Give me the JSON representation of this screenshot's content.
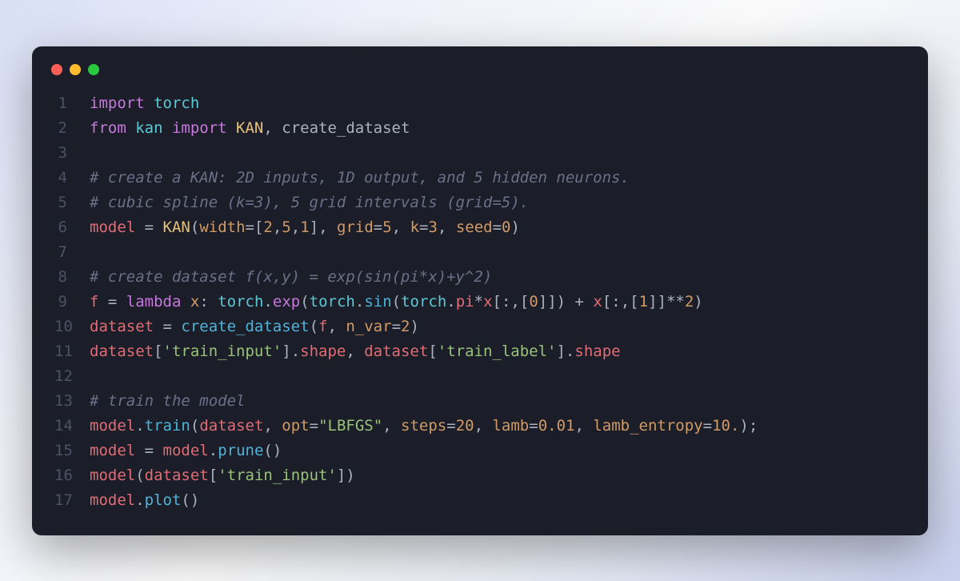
{
  "window": {
    "traffic_lights": [
      "red",
      "yellow",
      "green"
    ]
  },
  "lines": [
    {
      "n": "1",
      "tokens": [
        [
          "kw",
          "import "
        ],
        [
          "mod",
          "torch"
        ]
      ]
    },
    {
      "n": "2",
      "tokens": [
        [
          "kw",
          "from "
        ],
        [
          "mod",
          "kan "
        ],
        [
          "kw",
          "import "
        ],
        [
          "cls",
          "KAN"
        ],
        [
          "op",
          ", create_dataset"
        ]
      ]
    },
    {
      "n": "3",
      "tokens": []
    },
    {
      "n": "4",
      "tokens": [
        [
          "cmt",
          "# create a KAN: 2D inputs, 1D output, and 5 hidden neurons."
        ]
      ]
    },
    {
      "n": "5",
      "tokens": [
        [
          "cmt",
          "# cubic spline (k=3), 5 grid intervals (grid=5)."
        ]
      ]
    },
    {
      "n": "6",
      "tokens": [
        [
          "id",
          "model"
        ],
        [
          "op",
          " = "
        ],
        [
          "cls",
          "KAN"
        ],
        [
          "op",
          "("
        ],
        [
          "arg",
          "width"
        ],
        [
          "op",
          "=["
        ],
        [
          "num",
          "2"
        ],
        [
          "op",
          ","
        ],
        [
          "num",
          "5"
        ],
        [
          "op",
          ","
        ],
        [
          "num",
          "1"
        ],
        [
          "op",
          "], "
        ],
        [
          "arg",
          "grid"
        ],
        [
          "op",
          "="
        ],
        [
          "num",
          "5"
        ],
        [
          "op",
          ", "
        ],
        [
          "arg",
          "k"
        ],
        [
          "op",
          "="
        ],
        [
          "num",
          "3"
        ],
        [
          "op",
          ", "
        ],
        [
          "arg",
          "seed"
        ],
        [
          "op",
          "="
        ],
        [
          "num",
          "0"
        ],
        [
          "op",
          ")"
        ]
      ]
    },
    {
      "n": "7",
      "tokens": []
    },
    {
      "n": "8",
      "tokens": [
        [
          "cmt",
          "# create dataset f(x,y) = exp(sin(pi*x)+y^2)"
        ]
      ]
    },
    {
      "n": "9",
      "tokens": [
        [
          "id",
          "f"
        ],
        [
          "op",
          " = "
        ],
        [
          "kw",
          "lambda"
        ],
        [
          "op",
          " "
        ],
        [
          "arg",
          "x"
        ],
        [
          "op",
          ": "
        ],
        [
          "mod",
          "torch"
        ],
        [
          "op",
          "."
        ],
        [
          "pnk",
          "exp"
        ],
        [
          "op",
          "("
        ],
        [
          "mod",
          "torch"
        ],
        [
          "op",
          "."
        ],
        [
          "fn",
          "sin"
        ],
        [
          "op",
          "("
        ],
        [
          "mod",
          "torch"
        ],
        [
          "op",
          "."
        ],
        [
          "id",
          "pi"
        ],
        [
          "op",
          "*"
        ],
        [
          "id",
          "x"
        ],
        [
          "op",
          "[:,["
        ],
        [
          "num",
          "0"
        ],
        [
          "op",
          "]]) + "
        ],
        [
          "id",
          "x"
        ],
        [
          "op",
          "[:,["
        ],
        [
          "num",
          "1"
        ],
        [
          "op",
          "]]**"
        ],
        [
          "num",
          "2"
        ],
        [
          "op",
          ")"
        ]
      ]
    },
    {
      "n": "10",
      "tokens": [
        [
          "id",
          "dataset"
        ],
        [
          "op",
          " = "
        ],
        [
          "fn",
          "create_dataset"
        ],
        [
          "op",
          "("
        ],
        [
          "id",
          "f"
        ],
        [
          "op",
          ", "
        ],
        [
          "arg",
          "n_var"
        ],
        [
          "op",
          "="
        ],
        [
          "num",
          "2"
        ],
        [
          "op",
          ")"
        ]
      ]
    },
    {
      "n": "11",
      "tokens": [
        [
          "id",
          "dataset"
        ],
        [
          "op",
          "["
        ],
        [
          "str",
          "'train_input'"
        ],
        [
          "op",
          "]."
        ],
        [
          "id",
          "shape"
        ],
        [
          "op",
          ", "
        ],
        [
          "id",
          "dataset"
        ],
        [
          "op",
          "["
        ],
        [
          "str",
          "'train_label'"
        ],
        [
          "op",
          "]."
        ],
        [
          "id",
          "shape"
        ]
      ]
    },
    {
      "n": "12",
      "tokens": []
    },
    {
      "n": "13",
      "tokens": [
        [
          "cmt",
          "# train the model"
        ]
      ]
    },
    {
      "n": "14",
      "tokens": [
        [
          "id",
          "model"
        ],
        [
          "op",
          "."
        ],
        [
          "fn",
          "train"
        ],
        [
          "op",
          "("
        ],
        [
          "id",
          "dataset"
        ],
        [
          "op",
          ", "
        ],
        [
          "arg",
          "opt"
        ],
        [
          "op",
          "="
        ],
        [
          "str",
          "\"LBFGS\""
        ],
        [
          "op",
          ", "
        ],
        [
          "arg",
          "steps"
        ],
        [
          "op",
          "="
        ],
        [
          "num",
          "20"
        ],
        [
          "op",
          ", "
        ],
        [
          "arg",
          "lamb"
        ],
        [
          "op",
          "="
        ],
        [
          "num",
          "0.01"
        ],
        [
          "op",
          ", "
        ],
        [
          "arg",
          "lamb_entropy"
        ],
        [
          "op",
          "="
        ],
        [
          "num",
          "10."
        ],
        [
          "op",
          ");"
        ]
      ]
    },
    {
      "n": "15",
      "tokens": [
        [
          "id",
          "model"
        ],
        [
          "op",
          " = "
        ],
        [
          "id",
          "model"
        ],
        [
          "op",
          "."
        ],
        [
          "fn",
          "prune"
        ],
        [
          "op",
          "()"
        ]
      ]
    },
    {
      "n": "16",
      "tokens": [
        [
          "id",
          "model"
        ],
        [
          "op",
          "("
        ],
        [
          "id",
          "dataset"
        ],
        [
          "op",
          "["
        ],
        [
          "str",
          "'train_input'"
        ],
        [
          "op",
          "])"
        ]
      ]
    },
    {
      "n": "17",
      "tokens": [
        [
          "id",
          "model"
        ],
        [
          "op",
          "."
        ],
        [
          "fn",
          "plot"
        ],
        [
          "op",
          "()"
        ]
      ]
    }
  ]
}
